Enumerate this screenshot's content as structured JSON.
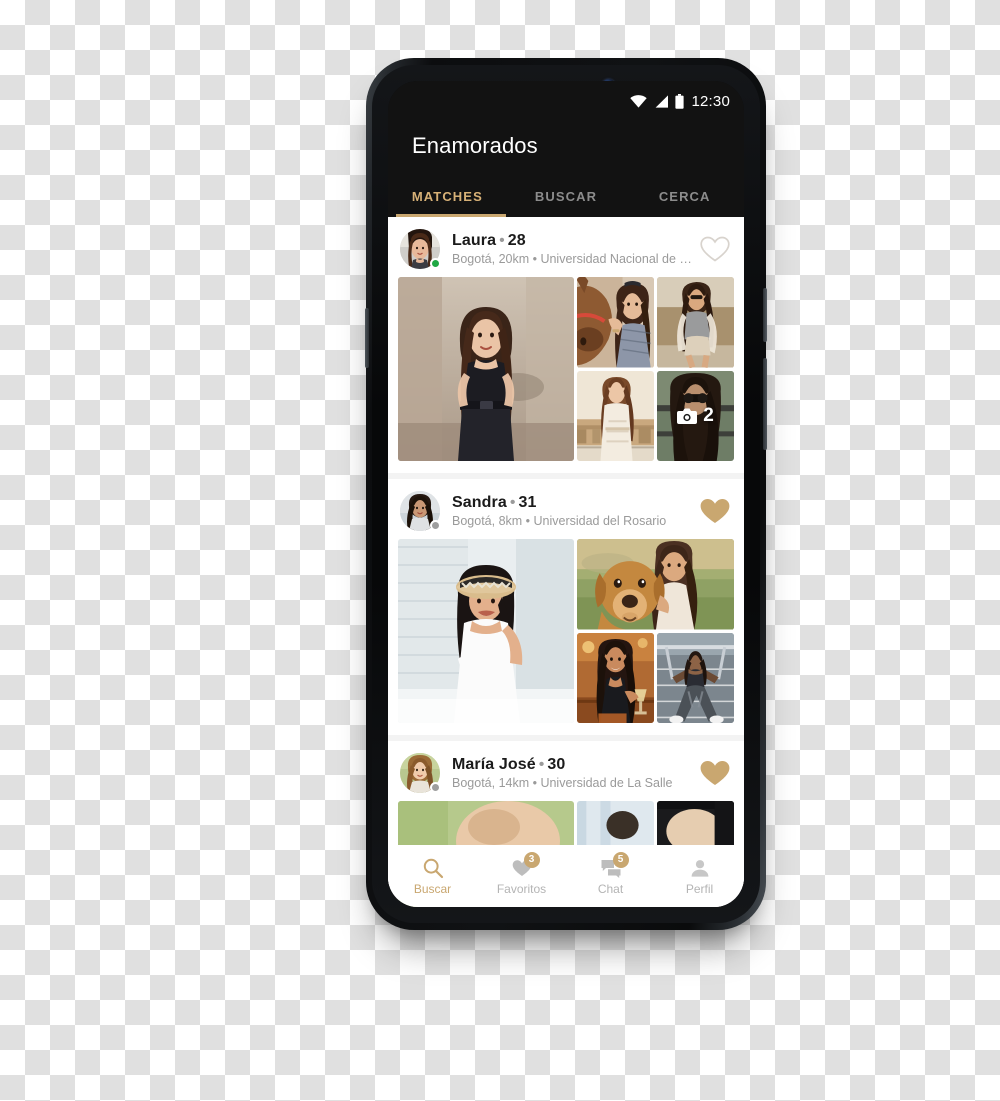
{
  "status_bar": {
    "time": "12:30",
    "icons": [
      "wifi-icon",
      "cell-signal-icon",
      "battery-icon"
    ]
  },
  "app": {
    "title": "Enamorados",
    "accent_color": "#c9a770",
    "appbar_color": "#121212"
  },
  "tabs": [
    {
      "label": "MATCHES",
      "active": true
    },
    {
      "label": "BUSCAR",
      "active": false
    },
    {
      "label": "CERCA",
      "active": false
    }
  ],
  "matches": [
    {
      "name": "Laura",
      "separator": "•",
      "age": "28",
      "meta": "Bogotá, 20km • Universidad Nacional de C...",
      "online": true,
      "favorited": false,
      "more_photos_count": "2",
      "more_photos_icon": "camera-icon"
    },
    {
      "name": "Sandra",
      "separator": "•",
      "age": "31",
      "meta": "Bogotá, 8km • Universidad del Rosario",
      "online": false,
      "favorited": true,
      "more_photos_count": "",
      "more_photos_icon": ""
    },
    {
      "name": "María José",
      "separator": "•",
      "age": "30",
      "meta": "Bogotá, 14km • Universidad de La Salle",
      "online": false,
      "favorited": true,
      "more_photos_count": "",
      "more_photos_icon": ""
    }
  ],
  "bottom_nav": [
    {
      "label": "Buscar",
      "icon": "search-icon",
      "active": true,
      "badge": ""
    },
    {
      "label": "Favoritos",
      "icon": "heart-icon",
      "active": false,
      "badge": "3"
    },
    {
      "label": "Chat",
      "icon": "chat-icon",
      "active": false,
      "badge": "5"
    },
    {
      "label": "Perfil",
      "icon": "person-icon",
      "active": false,
      "badge": ""
    }
  ]
}
